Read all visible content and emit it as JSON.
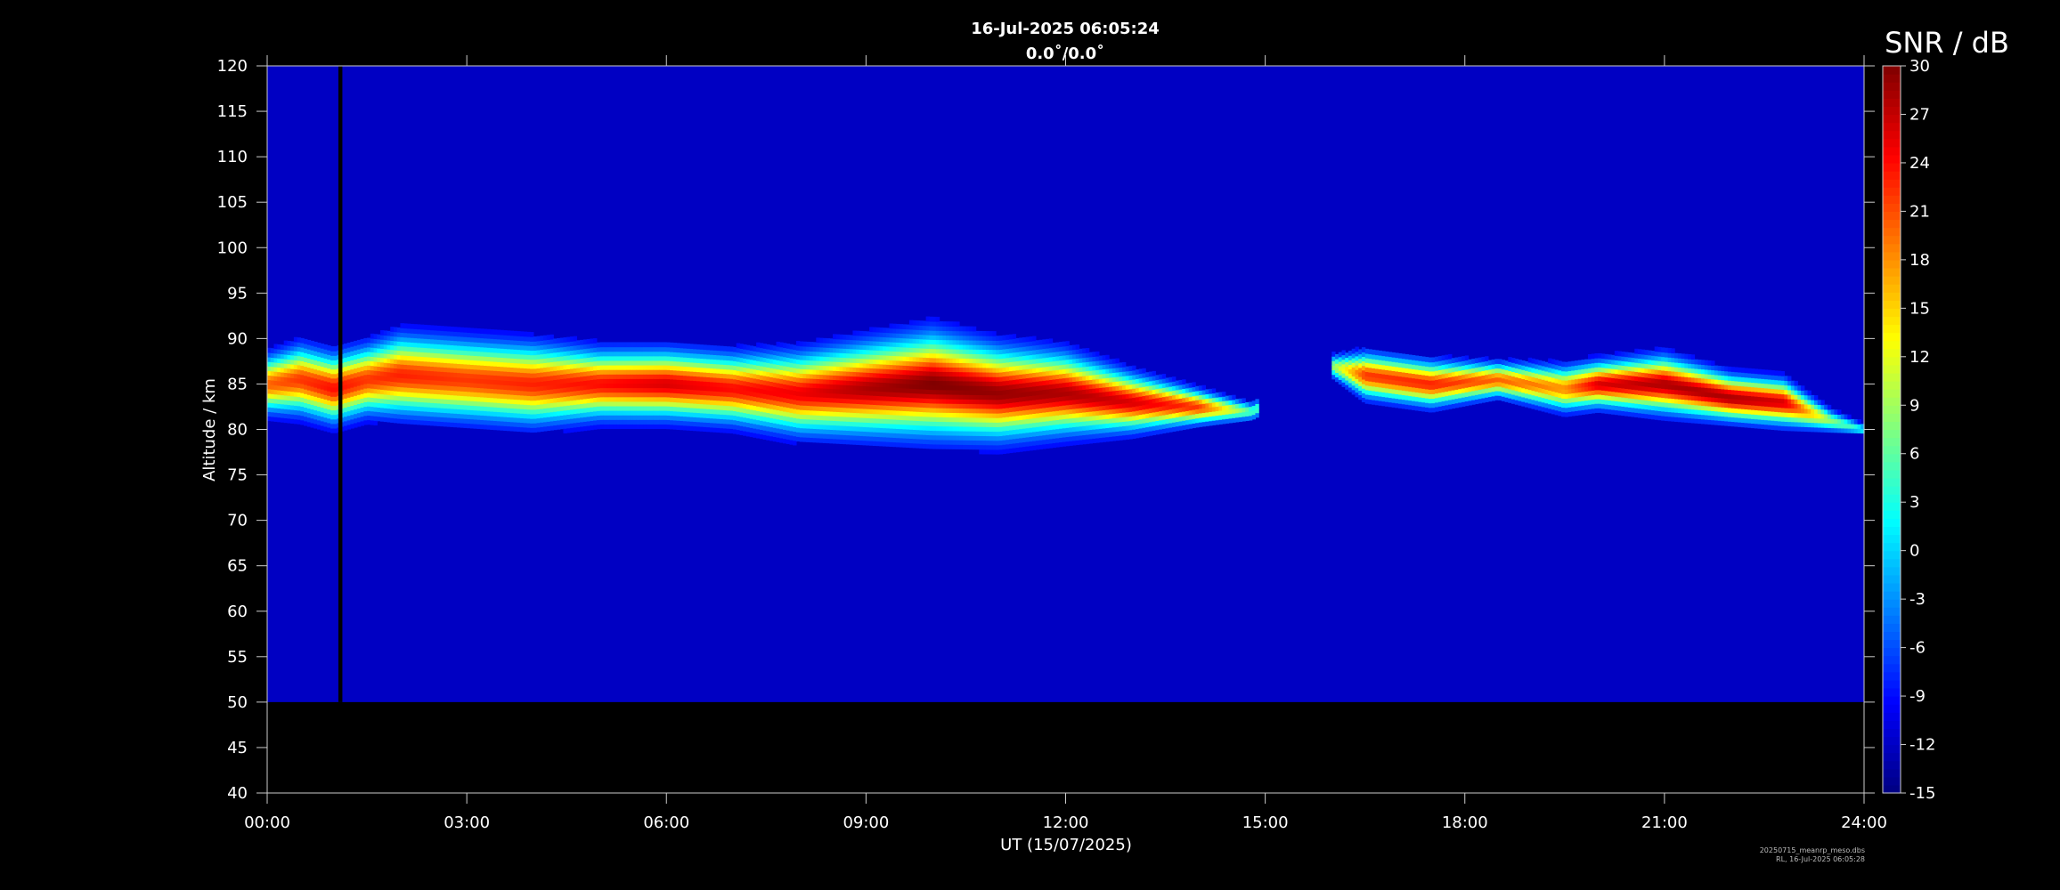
{
  "chart_data": {
    "type": "heatmap",
    "title": "16-Jul-2025 06:05:24",
    "subtitle": "0.0˚/0.0˚",
    "xlabel": "UT (15/07/2025)",
    "ylabel": "Altitude / km",
    "xlim": [
      0,
      24
    ],
    "ylim": [
      40,
      120
    ],
    "data_ylim": [
      50,
      120
    ],
    "x_tick_values": [
      0,
      3,
      6,
      9,
      12,
      15,
      18,
      21,
      24
    ],
    "x_tick_labels": [
      "00:00",
      "03:00",
      "06:00",
      "09:00",
      "12:00",
      "15:00",
      "18:00",
      "21:00",
      "24:00"
    ],
    "y_tick_values": [
      40,
      45,
      50,
      55,
      60,
      65,
      70,
      75,
      80,
      85,
      90,
      95,
      100,
      105,
      110,
      115,
      120
    ],
    "y_tick_labels": [
      "40",
      "45",
      "50",
      "55",
      "60",
      "65",
      "70",
      "75",
      "80",
      "85",
      "90",
      "95",
      "100",
      "105",
      "110",
      "115",
      "120"
    ],
    "colorbar": {
      "title": "SNR / dB",
      "min": -15,
      "max": 30,
      "colormap": "jet",
      "tick_values": [
        30,
        27,
        24,
        21,
        18,
        15,
        12,
        9,
        6,
        3,
        0,
        -3,
        -6,
        -9,
        -12,
        -15
      ],
      "tick_labels": [
        "30",
        "27",
        "24",
        "21",
        "18",
        "15",
        "12",
        "9",
        "6",
        "3",
        "0",
        "-3",
        "-6",
        "-9",
        "-12",
        "-15"
      ]
    },
    "background_snr": -12,
    "data_gap_hours": [
      1.07,
      1.13
    ],
    "echo_layer": {
      "description_points": [
        {
          "time": 0.0,
          "center_km": 85.0,
          "half_width_km": 2.5,
          "peak_snr": 20
        },
        {
          "time": 0.5,
          "center_km": 85.5,
          "half_width_km": 3.0,
          "peak_snr": 22
        },
        {
          "time": 1.0,
          "center_km": 84.5,
          "half_width_km": 3.0,
          "peak_snr": 24
        },
        {
          "time": 1.5,
          "center_km": 85.5,
          "half_width_km": 3.0,
          "peak_snr": 22
        },
        {
          "time": 2.0,
          "center_km": 86.0,
          "half_width_km": 3.5,
          "peak_snr": 23
        },
        {
          "time": 3.0,
          "center_km": 85.5,
          "half_width_km": 3.5,
          "peak_snr": 22
        },
        {
          "time": 4.0,
          "center_km": 85.0,
          "half_width_km": 3.5,
          "peak_snr": 23
        },
        {
          "time": 5.0,
          "center_km": 85.0,
          "half_width_km": 3.0,
          "peak_snr": 24
        },
        {
          "time": 6.0,
          "center_km": 85.0,
          "half_width_km": 3.0,
          "peak_snr": 26
        },
        {
          "time": 7.0,
          "center_km": 84.5,
          "half_width_km": 3.0,
          "peak_snr": 24
        },
        {
          "time": 8.0,
          "center_km": 84.0,
          "half_width_km": 3.5,
          "peak_snr": 25
        },
        {
          "time": 9.0,
          "center_km": 84.5,
          "half_width_km": 4.0,
          "peak_snr": 28
        },
        {
          "time": 10.0,
          "center_km": 85.0,
          "half_width_km": 4.5,
          "peak_snr": 30
        },
        {
          "time": 11.0,
          "center_km": 84.0,
          "half_width_km": 4.0,
          "peak_snr": 29
        },
        {
          "time": 12.0,
          "center_km": 84.0,
          "half_width_km": 3.5,
          "peak_snr": 28
        },
        {
          "time": 13.0,
          "center_km": 83.0,
          "half_width_km": 2.5,
          "peak_snr": 26
        },
        {
          "time": 14.0,
          "center_km": 82.5,
          "half_width_km": 1.5,
          "peak_snr": 22
        },
        {
          "time": 14.8,
          "center_km": 82.0,
          "half_width_km": 0.8,
          "peak_snr": 5
        },
        {
          "time": 16.0,
          "center_km": 87.0,
          "half_width_km": 1.0,
          "peak_snr": 8
        },
        {
          "time": 16.5,
          "center_km": 86.0,
          "half_width_km": 2.0,
          "peak_snr": 22
        },
        {
          "time": 17.5,
          "center_km": 85.0,
          "half_width_km": 2.0,
          "peak_snr": 23
        },
        {
          "time": 18.5,
          "center_km": 85.5,
          "half_width_km": 1.5,
          "peak_snr": 20
        },
        {
          "time": 19.5,
          "center_km": 84.5,
          "half_width_km": 2.0,
          "peak_snr": 18
        },
        {
          "time": 20.0,
          "center_km": 85.0,
          "half_width_km": 2.0,
          "peak_snr": 26
        },
        {
          "time": 21.0,
          "center_km": 85.0,
          "half_width_km": 2.5,
          "peak_snr": 28
        },
        {
          "time": 22.0,
          "center_km": 83.5,
          "half_width_km": 2.0,
          "peak_snr": 28
        },
        {
          "time": 22.8,
          "center_km": 83.0,
          "half_width_km": 2.0,
          "peak_snr": 26
        },
        {
          "time": 23.5,
          "center_km": 81.0,
          "half_width_km": 1.0,
          "peak_snr": 8
        },
        {
          "time": 24.0,
          "center_km": 80.0,
          "half_width_km": 0.5,
          "peak_snr": 2
        }
      ],
      "gaps": [
        [
          14.9,
          16.0
        ]
      ]
    }
  },
  "footer": {
    "line1": "20250715_meanrp_meso.dbs",
    "line2": "RL, 16-Jul-2025 06:05:28"
  }
}
